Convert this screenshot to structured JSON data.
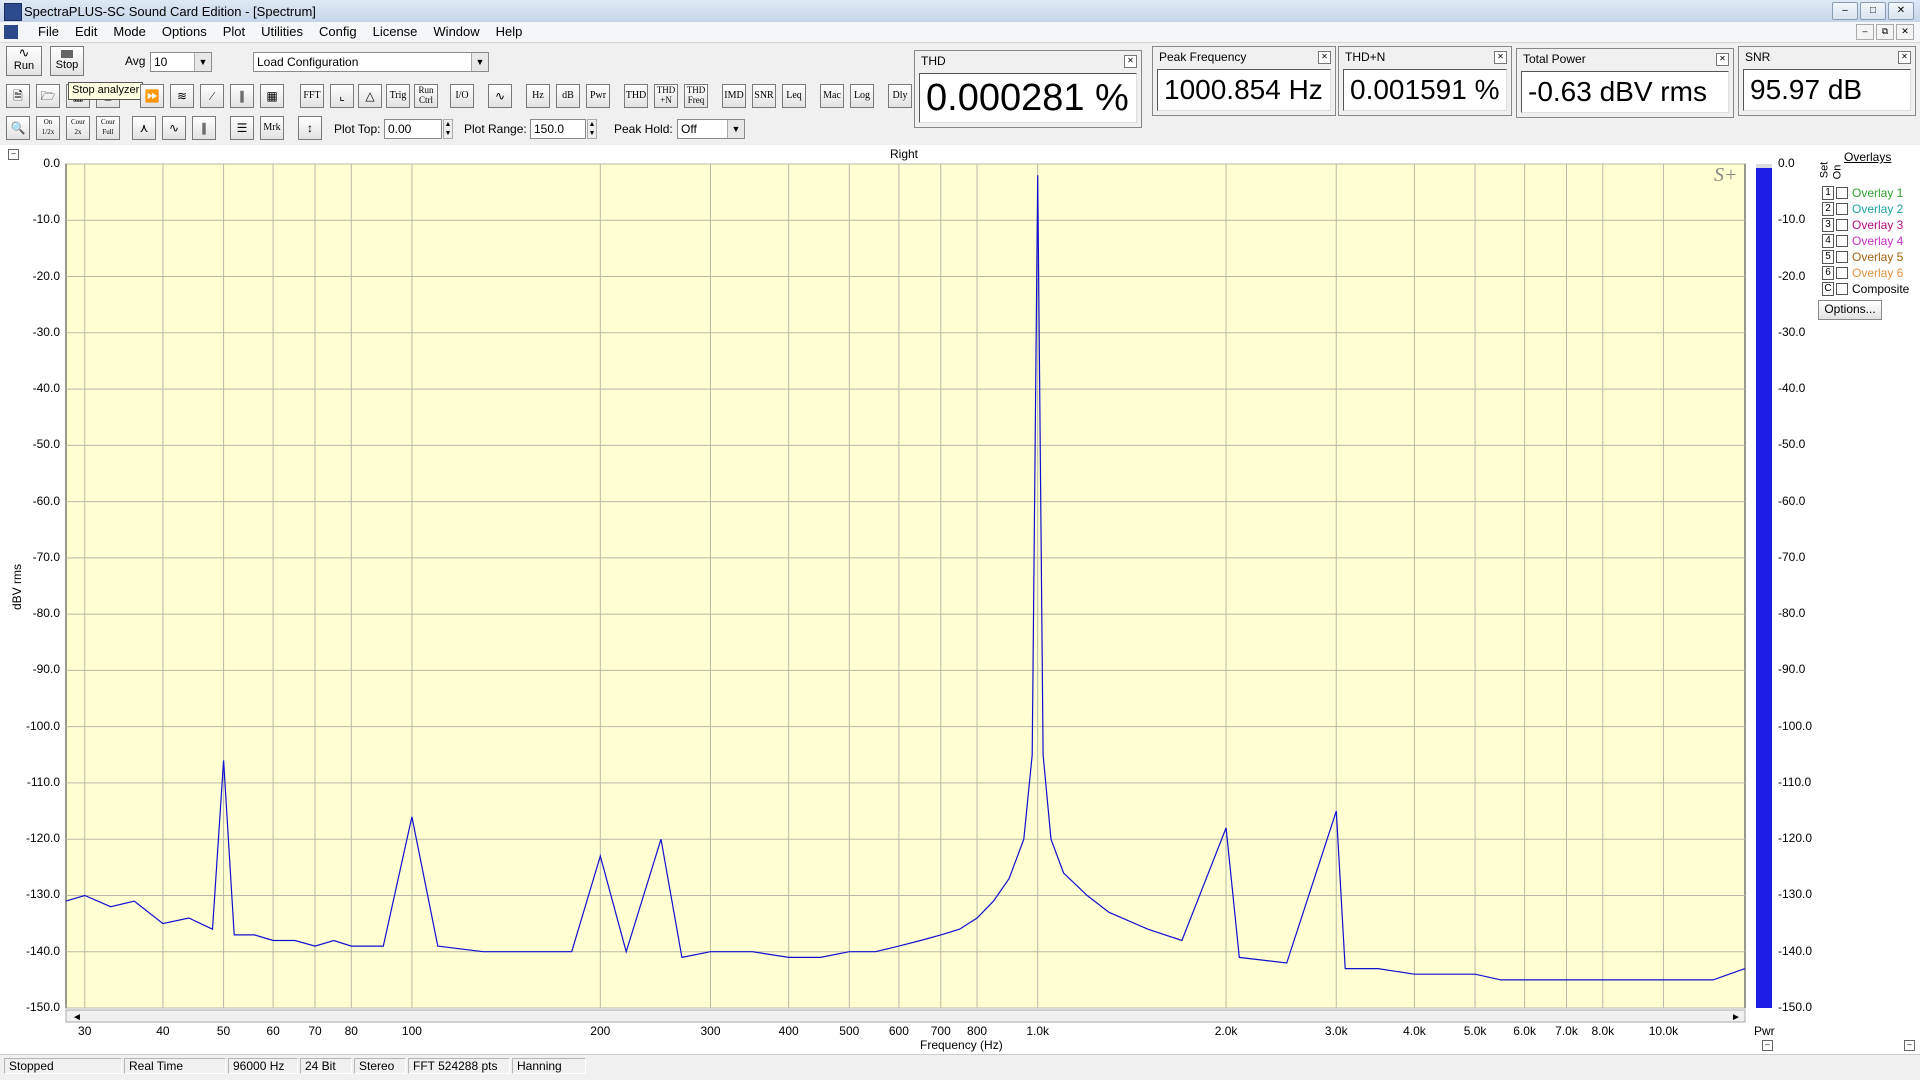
{
  "window": {
    "title": "SpectraPLUS-SC Sound Card Edition - [Spectrum]"
  },
  "menu": [
    "File",
    "Edit",
    "Mode",
    "Options",
    "Plot",
    "Utilities",
    "Config",
    "License",
    "Window",
    "Help"
  ],
  "toolbar": {
    "run_label": "Run",
    "stop_label": "Stop",
    "avg_label": "Avg",
    "avg_value": "10",
    "config_value": "Load Configuration",
    "tooltip": "Stop analyzer",
    "row2_buttons": [
      "FFT",
      "Trig",
      "Run Ctrl",
      "I/O",
      "Hz",
      "dB",
      "Pwr",
      "THD",
      "THD +N",
      "THD Freq",
      "IMD",
      "SNR",
      "Leq",
      "Mac",
      "Log",
      "Dly"
    ],
    "row3_buttons": [
      "Mrk"
    ],
    "cour_labels": [
      "On 1/2x",
      "Cour 2x",
      "Cour Full"
    ],
    "plot_top_label": "Plot Top:",
    "plot_top_value": "0.00",
    "plot_range_label": "Plot Range:",
    "plot_range_value": "150.0",
    "peak_hold_label": "Peak Hold:",
    "peak_hold_value": "Off"
  },
  "meters": {
    "thd": {
      "title": "THD",
      "value": "0.000281 %"
    },
    "peak_freq": {
      "title": "Peak Frequency",
      "value": "1000.854 Hz"
    },
    "thdn": {
      "title": "THD+N",
      "value": "0.001591 %"
    },
    "total_power": {
      "title": "Total Power",
      "value": "-0.63 dBV rms"
    },
    "snr": {
      "title": "SNR",
      "value": "95.97 dB"
    }
  },
  "overlays": {
    "title": "Overlays",
    "set_label": "Set",
    "on_label": "On",
    "items": [
      {
        "num": "1",
        "label": "Overlay 1",
        "color": "#2e9e2e"
      },
      {
        "num": "2",
        "label": "Overlay 2",
        "color": "#20a0a0"
      },
      {
        "num": "3",
        "label": "Overlay 3",
        "color": "#b01080"
      },
      {
        "num": "4",
        "label": "Overlay 4",
        "color": "#c030c0"
      },
      {
        "num": "5",
        "label": "Overlay 5",
        "color": "#a06010"
      },
      {
        "num": "6",
        "label": "Overlay 6",
        "color": "#e09040"
      },
      {
        "num": "C",
        "label": "Composite",
        "color": "#000000"
      }
    ],
    "options_label": "Options..."
  },
  "power_bar": {
    "label": "Pwr",
    "level_db": -0.63
  },
  "plot": {
    "brand_mark": "S+"
  },
  "chart_data": {
    "type": "line",
    "title": "Right",
    "xlabel": "Frequency (Hz)",
    "ylabel": "dBV rms",
    "x_scale": "log",
    "xlim": [
      28,
      13500
    ],
    "ylim": [
      -150,
      0
    ],
    "yticks": [
      "0.0",
      "-10.0",
      "-20.0",
      "-30.0",
      "-40.0",
      "-50.0",
      "-60.0",
      "-70.0",
      "-80.0",
      "-90.0",
      "-100.0",
      "-110.0",
      "-120.0",
      "-130.0",
      "-140.0",
      "-150.0"
    ],
    "xticks": [
      {
        "v": 30,
        "t": "30"
      },
      {
        "v": 40,
        "t": "40"
      },
      {
        "v": 50,
        "t": "50"
      },
      {
        "v": 60,
        "t": "60"
      },
      {
        "v": 70,
        "t": "70"
      },
      {
        "v": 80,
        "t": "80"
      },
      {
        "v": 100,
        "t": "100"
      },
      {
        "v": 200,
        "t": "200"
      },
      {
        "v": 300,
        "t": "300"
      },
      {
        "v": 400,
        "t": "400"
      },
      {
        "v": 500,
        "t": "500"
      },
      {
        "v": 600,
        "t": "600"
      },
      {
        "v": 700,
        "t": "700"
      },
      {
        "v": 800,
        "t": "800"
      },
      {
        "v": 1000,
        "t": "1.0k"
      },
      {
        "v": 2000,
        "t": "2.0k"
      },
      {
        "v": 3000,
        "t": "3.0k"
      },
      {
        "v": 4000,
        "t": "4.0k"
      },
      {
        "v": 5000,
        "t": "5.0k"
      },
      {
        "v": 6000,
        "t": "6.0k"
      },
      {
        "v": 7000,
        "t": "7.0k"
      },
      {
        "v": 8000,
        "t": "8.0k"
      },
      {
        "v": 10000,
        "t": "10.0k"
      }
    ],
    "grid": true,
    "series": [
      {
        "color": "#1010d0",
        "points": [
          [
            28,
            -131
          ],
          [
            30,
            -130
          ],
          [
            33,
            -132
          ],
          [
            36,
            -131
          ],
          [
            40,
            -135
          ],
          [
            44,
            -134
          ],
          [
            48,
            -136
          ],
          [
            50,
            -106
          ],
          [
            52,
            -137
          ],
          [
            56,
            -137
          ],
          [
            60,
            -138
          ],
          [
            65,
            -138
          ],
          [
            70,
            -139
          ],
          [
            75,
            -138
          ],
          [
            80,
            -139
          ],
          [
            90,
            -139
          ],
          [
            100,
            -116
          ],
          [
            110,
            -139
          ],
          [
            130,
            -140
          ],
          [
            150,
            -140
          ],
          [
            180,
            -140
          ],
          [
            200,
            -123
          ],
          [
            220,
            -140
          ],
          [
            250,
            -120
          ],
          [
            270,
            -141
          ],
          [
            300,
            -140
          ],
          [
            350,
            -140
          ],
          [
            400,
            -141
          ],
          [
            450,
            -141
          ],
          [
            500,
            -140
          ],
          [
            550,
            -140
          ],
          [
            600,
            -139
          ],
          [
            650,
            -138
          ],
          [
            700,
            -137
          ],
          [
            750,
            -136
          ],
          [
            800,
            -134
          ],
          [
            850,
            -131
          ],
          [
            900,
            -127
          ],
          [
            950,
            -120
          ],
          [
            980,
            -105
          ],
          [
            1000,
            -2
          ],
          [
            1020,
            -105
          ],
          [
            1050,
            -120
          ],
          [
            1100,
            -126
          ],
          [
            1200,
            -130
          ],
          [
            1300,
            -133
          ],
          [
            1500,
            -136
          ],
          [
            1700,
            -138
          ],
          [
            2000,
            -118
          ],
          [
            2100,
            -141
          ],
          [
            2500,
            -142
          ],
          [
            3000,
            -115
          ],
          [
            3100,
            -143
          ],
          [
            3500,
            -143
          ],
          [
            4000,
            -144
          ],
          [
            4500,
            -144
          ],
          [
            5000,
            -144
          ],
          [
            5500,
            -145
          ],
          [
            6000,
            -145
          ],
          [
            7000,
            -145
          ],
          [
            8000,
            -145
          ],
          [
            9000,
            -145
          ],
          [
            10000,
            -145
          ],
          [
            11000,
            -145
          ],
          [
            12000,
            -145
          ],
          [
            13500,
            -143
          ]
        ]
      }
    ]
  },
  "status": [
    "Stopped",
    "Real Time",
    "96000 Hz",
    "24 Bit",
    "Stereo",
    "FFT 524288 pts",
    "Hanning"
  ]
}
